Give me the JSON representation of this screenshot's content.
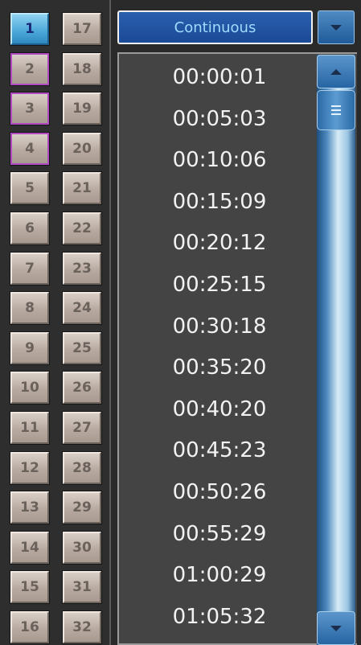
{
  "channels": {
    "left": [
      "1",
      "2",
      "3",
      "4",
      "5",
      "6",
      "7",
      "8",
      "9",
      "10",
      "11",
      "12",
      "13",
      "14",
      "15",
      "16"
    ],
    "right": [
      "17",
      "18",
      "19",
      "20",
      "21",
      "22",
      "23",
      "24",
      "25",
      "26",
      "27",
      "28",
      "29",
      "30",
      "31",
      "32"
    ],
    "selected": "1",
    "marked": [
      "2",
      "3",
      "4"
    ]
  },
  "mode_select": {
    "value": "Continuous"
  },
  "timecodes": [
    "00:00:01",
    "00:05:03",
    "00:10:06",
    "00:15:09",
    "00:20:12",
    "00:25:15",
    "00:30:18",
    "00:35:20",
    "00:40:20",
    "00:45:23",
    "00:50:26",
    "00:55:29",
    "01:00:29",
    "01:05:32"
  ],
  "icons": {
    "dropdown": "chevron-down-icon",
    "scroll_up": "arrow-up-icon",
    "scroll_down": "arrow-down-icon",
    "thumb": "grip-icon"
  },
  "colors": {
    "selected_channel": "#4aa7d8",
    "marked_border": "#b04ac0",
    "list_bg": "#444444",
    "dropdown_bg": "#1b4a96"
  }
}
